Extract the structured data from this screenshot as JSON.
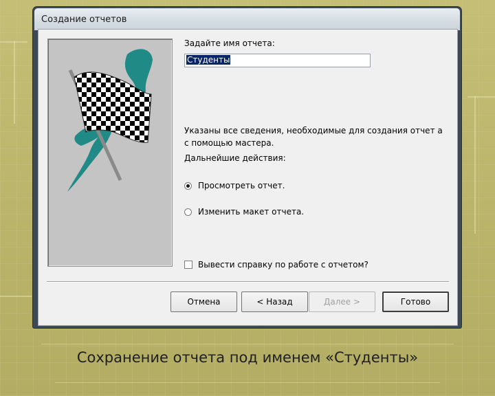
{
  "dialog": {
    "title": "Создание отчетов",
    "name_prompt": "Задайте имя отчета:",
    "report_name_value": "Студенты",
    "info_text": "Указаны все сведения, необходимые для создания отчет а с помощью мастера.",
    "next_actions_label": "Дальнейшие действия:",
    "options": [
      {
        "label": "Просмотреть отчет.",
        "selected": true
      },
      {
        "label": "Изменить макет отчета.",
        "selected": false
      }
    ],
    "help_checkbox_label": "Вывести справку по работе с отчетом?",
    "help_checkbox_checked": false,
    "buttons": {
      "cancel": "Отмена",
      "back": "< Назад",
      "next": "Далее >",
      "finish": "Готово"
    },
    "image_icon": "checkered-flag-icon"
  },
  "slide_caption": "Сохранение отчета под именем «Студенты»",
  "colors": {
    "background": "#b9b36a",
    "dialog_face": "#f0f0f0",
    "image_panel": "#c4c4c4",
    "flag_accent": "#1f8a86",
    "selection": "#0a246a"
  }
}
